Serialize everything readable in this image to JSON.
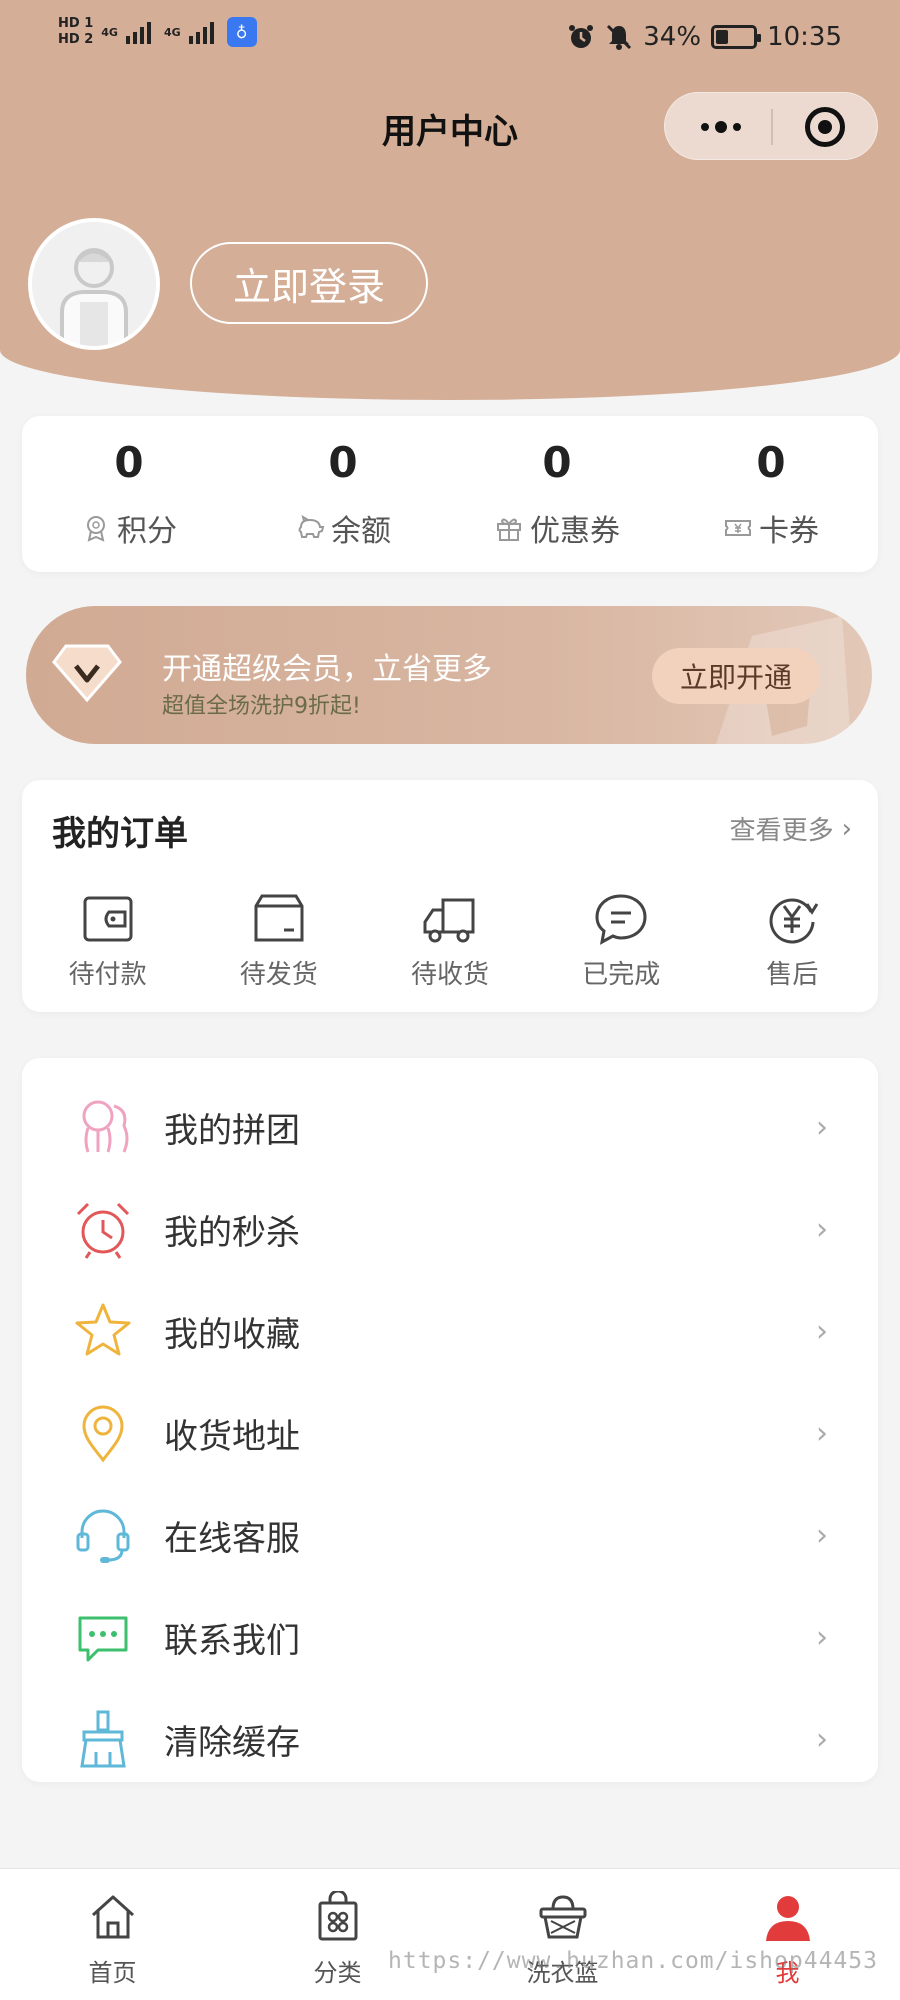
{
  "status_bar": {
    "hd1": "HD 1",
    "hd2": "HD 2",
    "net1": "4G",
    "net2": "4G",
    "battery": "34%",
    "battery_level": 0.34,
    "time": "10:35"
  },
  "nav": {
    "title": "用户中心"
  },
  "user": {
    "login_label": "立即登录"
  },
  "stats": [
    {
      "value": "0",
      "label": "积分",
      "icon": "medal-icon"
    },
    {
      "value": "0",
      "label": "余额",
      "icon": "piggy-bank-icon"
    },
    {
      "value": "0",
      "label": "优惠券",
      "icon": "gift-icon"
    },
    {
      "value": "0",
      "label": "卡券",
      "icon": "ticket-icon"
    }
  ],
  "vip": {
    "title": "开通超级会员，立省更多",
    "subtitle": "超值全场洗护9折起!",
    "button": "立即开通"
  },
  "orders": {
    "title": "我的订单",
    "more": "查看更多",
    "items": [
      {
        "label": "待付款",
        "icon": "wallet-icon"
      },
      {
        "label": "待发货",
        "icon": "box-icon"
      },
      {
        "label": "待收货",
        "icon": "truck-icon"
      },
      {
        "label": "已完成",
        "icon": "chat-bubble-icon"
      },
      {
        "label": "售后",
        "icon": "yen-refresh-icon"
      }
    ]
  },
  "menu": [
    {
      "label": "我的拼团",
      "icon": "group-icon",
      "color": "#f0a3c0"
    },
    {
      "label": "我的秒杀",
      "icon": "alarm-clock-icon",
      "color": "#e25858"
    },
    {
      "label": "我的收藏",
      "icon": "star-icon",
      "color": "#efb43c"
    },
    {
      "label": "收货地址",
      "icon": "location-pin-icon",
      "color": "#efb43c"
    },
    {
      "label": "在线客服",
      "icon": "headset-icon",
      "color": "#5fb8d8"
    },
    {
      "label": "联系我们",
      "icon": "message-icon",
      "color": "#3cc06d"
    },
    {
      "label": "清除缓存",
      "icon": "broom-icon",
      "color": "#5fb8d8"
    }
  ],
  "tabbar": [
    {
      "label": "首页",
      "icon": "home-icon",
      "active": false
    },
    {
      "label": "分类",
      "icon": "category-bag-icon",
      "active": false
    },
    {
      "label": "洗衣篮",
      "icon": "basket-icon",
      "active": false
    },
    {
      "label": "我",
      "icon": "person-icon",
      "active": true
    }
  ],
  "watermark": "https://www.huzhan.com/ishop44453",
  "colors": {
    "header": "#d4ae97",
    "accent_active": "#e23b3b",
    "vip_button": "#f2d2bd"
  }
}
